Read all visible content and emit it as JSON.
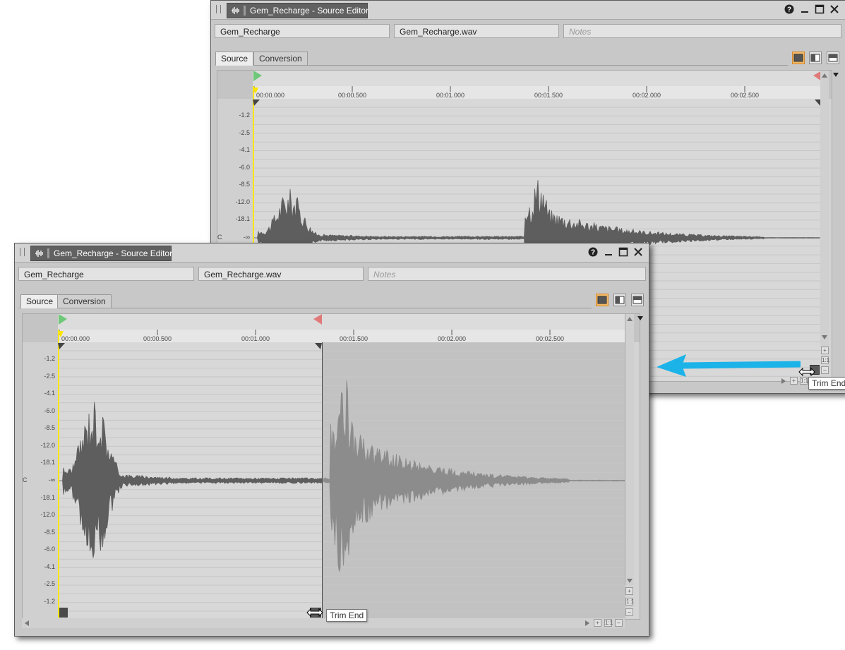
{
  "window_back": {
    "title": "Gem_Recharge - Source Editor",
    "name_field": "Gem_Recharge",
    "file_field": "Gem_Recharge.wav",
    "notes_placeholder": "Notes",
    "tabs": [
      "Source",
      "Conversion"
    ],
    "active_tab": "Source",
    "tooltip": "Trim End"
  },
  "window_front": {
    "title": "Gem_Recharge - Source Editor",
    "name_field": "Gem_Recharge",
    "file_field": "Gem_Recharge.wav",
    "notes_placeholder": "Notes",
    "tabs": [
      "Source",
      "Conversion"
    ],
    "active_tab": "Source",
    "tooltip": "Trim End"
  },
  "timeline_ticks": [
    "00:00.000",
    "00:00.500",
    "00:01.000",
    "00:01.500",
    "00:02.000",
    "00:02.500"
  ],
  "db_labels_top": [
    "-1.2",
    "-2.5",
    "-4.1",
    "-6.0",
    "-8.5",
    "-12.0",
    "-18.1"
  ],
  "db_labels_center": "-∞",
  "db_labels_bottom": [
    "-18.1",
    "-12.0",
    "-8.5",
    "-6.0",
    "-4.1",
    "-2.5",
    "-1.2"
  ],
  "channel_label": "C",
  "icons": {
    "help": "help-icon",
    "minimize": "minimize-icon",
    "maximize": "maximize-icon",
    "close": "close-icon",
    "view_single": "view-single-icon",
    "view_split_h": "view-split-horizontal-icon",
    "view_split_v": "view-split-vertical-icon",
    "trim_begin": "trim-begin-marker-icon",
    "trim_end": "trim-end-marker-icon",
    "resize_cursor": "resize-horizontal-cursor-icon",
    "arrow": "blue-arrow-annotation-icon"
  },
  "colors": {
    "accent_orange": "#f2b96a",
    "playhead_yellow": "#ffe600",
    "trim_begin_green": "#6fc87a",
    "trim_end_red": "#e07a7a",
    "annotation_blue": "#1cb3e8",
    "waveform": "#5e5e5e",
    "waveform_trimmed": "#8c8c8c"
  }
}
